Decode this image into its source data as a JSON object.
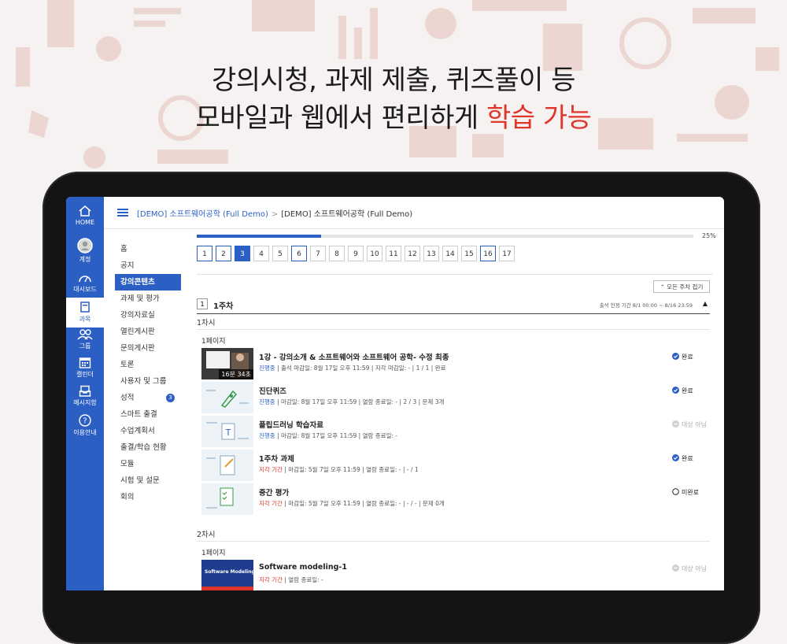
{
  "headline": {
    "line1": "강의시청,  과제 제출, 퀴즈풀이 등",
    "line2_prefix": "모바일과 웹에서 편리하게 ",
    "line2_highlight": "학습 가능"
  },
  "colors": {
    "accent": "#2c5fc4",
    "highlight": "#e0352a"
  },
  "global_nav": [
    {
      "label": "HOME",
      "icon": "home-icon"
    },
    {
      "label": "계정",
      "icon": "avatar-icon"
    },
    {
      "label": "대시보드",
      "icon": "dashboard-icon"
    },
    {
      "label": "과목",
      "icon": "book-icon",
      "active": true
    },
    {
      "label": "그룹",
      "icon": "group-icon"
    },
    {
      "label": "캘린더",
      "icon": "calendar-icon"
    },
    {
      "label": "메시지함",
      "icon": "inbox-icon"
    },
    {
      "label": "이용안내",
      "icon": "help-icon"
    }
  ],
  "breadcrumb": {
    "first": "[DEMO] 소프트웨어공학 (Full Demo)",
    "separator": ">",
    "second": "[DEMO] 소프트웨어공학 (Full Demo)"
  },
  "course_menu": [
    {
      "label": "홈"
    },
    {
      "label": "공지"
    },
    {
      "label": "강의콘텐츠",
      "active": true
    },
    {
      "label": "과제 및 평가"
    },
    {
      "label": "강의자료실"
    },
    {
      "label": "열린게시판"
    },
    {
      "label": "문의게시판"
    },
    {
      "label": "토론"
    },
    {
      "label": "사용자 및 그룹"
    },
    {
      "label": "성적",
      "badge": "3"
    },
    {
      "label": "스마트 출결"
    },
    {
      "label": "수업계획서"
    },
    {
      "label": "출결/학습 현황"
    },
    {
      "label": "모듈"
    },
    {
      "label": "시험 및 설문"
    },
    {
      "label": "회의"
    }
  ],
  "progress": {
    "percent_label": "25%",
    "value": 0.25
  },
  "pages": [
    {
      "n": "1",
      "state": "done"
    },
    {
      "n": "2",
      "state": "done"
    },
    {
      "n": "3",
      "state": "current"
    },
    {
      "n": "4",
      "state": ""
    },
    {
      "n": "5",
      "state": ""
    },
    {
      "n": "6",
      "state": "done"
    },
    {
      "n": "7",
      "state": ""
    },
    {
      "n": "8",
      "state": ""
    },
    {
      "n": "9",
      "state": ""
    },
    {
      "n": "10",
      "state": ""
    },
    {
      "n": "11",
      "state": ""
    },
    {
      "n": "12",
      "state": ""
    },
    {
      "n": "13",
      "state": ""
    },
    {
      "n": "14",
      "state": ""
    },
    {
      "n": "15",
      "state": ""
    },
    {
      "n": "16",
      "state": "done"
    },
    {
      "n": "17",
      "state": ""
    }
  ],
  "fold_all": "⌃ 모든 주차 접기",
  "week": {
    "number": "1",
    "title": "1주차",
    "period": "출석 인정 기간  8/1 00:00 ~ 8/16 23:59",
    "toggle": "▲"
  },
  "sessions": [
    {
      "label": "1차시",
      "page_label": "1페이지",
      "items": [
        {
          "thumb": "video",
          "duration": "16분 34초",
          "title": "1강 - 강의소개 & 소프트웨어와 소프트웨어 공학- 수정 최종",
          "who": "진행중",
          "who_style": "who",
          "meta": " | 출석 마감일: 8월 17일 오후 11:59  | 지각 마감일: -  | 1 / 1 | 완료",
          "status": "완료",
          "status_icon": "check-circle-icon"
        },
        {
          "thumb": "quiz",
          "title": "진단퀴즈",
          "who": "진행중",
          "who_style": "who",
          "meta": " | 마감일: 8월 17일 오후 11:59  | 열람 종료일: -  | 2 / 3 | 문제 3개",
          "status": "완료",
          "status_icon": "check-circle-icon"
        },
        {
          "thumb": "doc",
          "title": "플립드러닝 학습자료",
          "who": "진행중",
          "who_style": "who",
          "meta": " | 마감일: 8월 17일 오후 11:59  | 열람 종료일: -",
          "status": "대상 아님",
          "status_icon": "minus-circle-icon"
        },
        {
          "thumb": "assign",
          "title": "1주차 과제",
          "who": "지각 기간",
          "who_style": "late",
          "meta": " | 마감일: 5월 7일 오후 11:59  | 열람 종료일: -  | - / 1",
          "status": "완료",
          "status_icon": "check-circle-icon"
        },
        {
          "thumb": "exam",
          "title": "중간 평가",
          "who": "지각 기간",
          "who_style": "late",
          "meta": " | 마감일: 5월 7일 오후 11:59  | 열람 종료일: -  | - / - | 문제 0개",
          "status": "미완료",
          "status_icon": "empty-circle-icon"
        }
      ]
    },
    {
      "label": "2차시",
      "page_label": "1페이지",
      "items": [
        {
          "thumb": "slide",
          "slide_text": "Software Modeling",
          "title": "Software modeling-1",
          "who": "지각 기간",
          "who_style": "late",
          "meta": " | 열람 종료일: -",
          "status": "대상 아님",
          "status_icon": "minus-circle-icon"
        }
      ]
    }
  ]
}
